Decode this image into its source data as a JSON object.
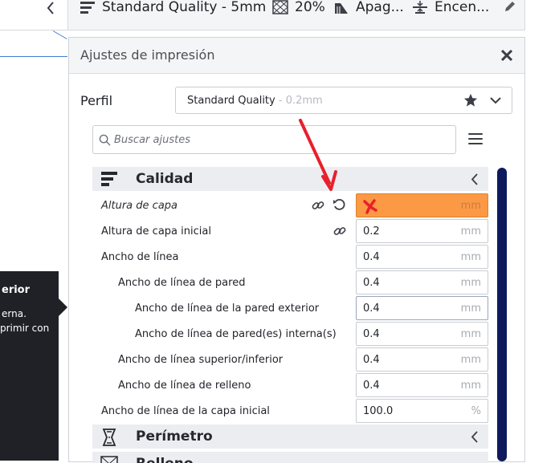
{
  "topbar": {
    "profile": "Standard Quality - 5mm",
    "infill": "20%",
    "support": "Apag...",
    "adhesion": "Encen..."
  },
  "tooltip": {
    "title": "erior",
    "line1": "erna.",
    "line2": "primir con"
  },
  "panel": {
    "title": "Ajustes de impresión",
    "profile_label": "Perfil",
    "profile_name": "Standard Quality",
    "profile_sub": " - 0.2mm",
    "search_placeholder": "Buscar ajustes"
  },
  "categories": [
    {
      "label": "Calidad"
    },
    {
      "label": "Perímetro"
    },
    {
      "label": "Relleno"
    }
  ],
  "settings": [
    {
      "label": "Altura de capa",
      "value": "",
      "unit": "mm"
    },
    {
      "label": "Altura de capa inicial",
      "value": "0.2",
      "unit": "mm"
    },
    {
      "label": "Ancho de línea",
      "value": "0.4",
      "unit": "mm"
    },
    {
      "label": "Ancho de línea de pared",
      "value": "0.4",
      "unit": "mm"
    },
    {
      "label": "Ancho de línea de la pared exterior",
      "value": "0.4",
      "unit": "mm"
    },
    {
      "label": "Ancho de línea de pared(es) interna(s)",
      "value": "0.4",
      "unit": "mm"
    },
    {
      "label": "Ancho de línea superior/inferior",
      "value": "0.4",
      "unit": "mm"
    },
    {
      "label": "Ancho de línea de relleno",
      "value": "0.4",
      "unit": "mm"
    },
    {
      "label": "Ancho de línea de la capa inicial",
      "value": "100.0",
      "unit": "%"
    }
  ],
  "colors": {
    "error_field": "#fb9945",
    "scrollbar": "#0e1a5c",
    "annotation": "#e8202c"
  }
}
